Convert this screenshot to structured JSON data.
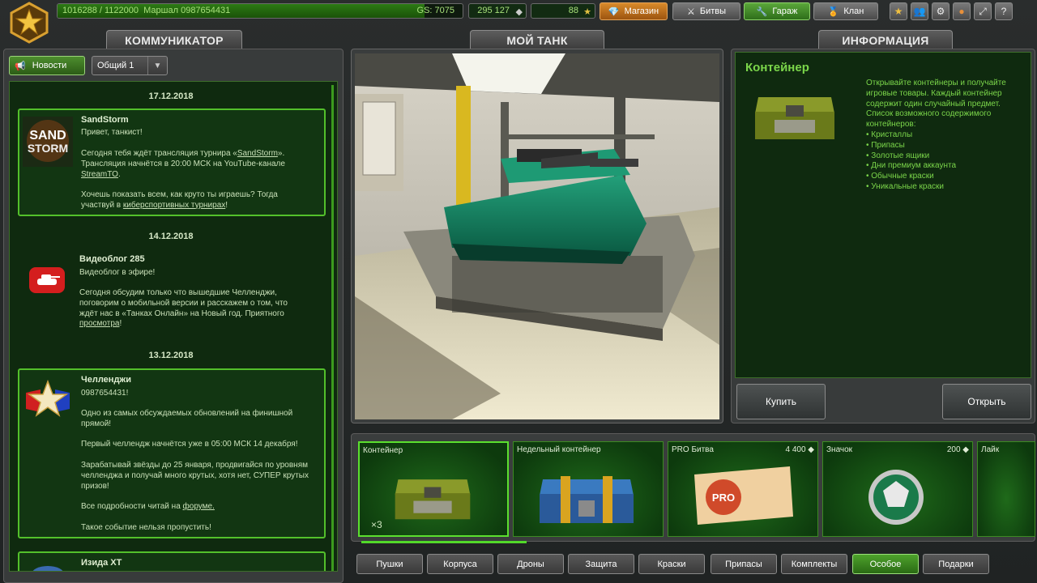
{
  "topbar": {
    "xp_text": "1016288 / 1122000",
    "rank_name": "Маршал",
    "player_name": "0987654431",
    "xp_progress": 0.906,
    "gs_text": "GS: 7075",
    "crystals": "295 127",
    "stars": "88",
    "shop_label": "Магазин",
    "battles_label": "Битвы",
    "garage_label": "Гараж",
    "clan_label": "Клан"
  },
  "tabs": {
    "communicator": "КОММУНИКАТОР",
    "my_tank": "МОЙ ТАНК",
    "info": "ИНФОРМАЦИЯ"
  },
  "communicator": {
    "news_button": "Новости",
    "channel_select": "Общий 1",
    "news": [
      {
        "date": "17.12.2018",
        "title": "SandStorm",
        "line1": "Привет, танкист!",
        "p1a": " Сегодня тебя ждёт трансляция турнира «",
        "p1link": "SandStorm",
        "p1b": "».",
        "p2a": "Трансляция начнётся в 20:00 МСК на YouTube-канале",
        "p2link": "StreamTO",
        "p2b": ".",
        "p3a": "Хочешь показать всем, как круто ты играешь? Тогда",
        "p3b": "участвуй в ",
        "p3link": "киберспортивных турнирах",
        "p3c": "!"
      },
      {
        "date": "14.12.2018",
        "title": "Видеоблог 285",
        "line1": "Видеоблог в эфире!",
        "p1": "Сегодня обсудим только что вышедшие Челленджи,",
        "p2": "поговорим о мобильной версии и расскажем о том, что",
        "p3": "ждёт нас в «Танках Онлайн» на Новый год. Приятного",
        "p4link": "просмотра",
        "p4b": "!"
      },
      {
        "date": "13.12.2018",
        "title": "Челленджи",
        "line1": "0987654431!",
        "p1": "Одно из самых обсуждаемых обновлений на финишной",
        "p1b": "прямой!",
        "p2": "Первый челлендж начнётся уже в 05:00 МСК 14 декабря!",
        "p3": "Зарабатывай звёзды до 25 января, продвигайся по уровням",
        "p3b": "челленджа и получай много крутых, хотя нет, СУПЕР крутых",
        "p3c": "призов!",
        "p4a": "Все подробности читай на ",
        "p4link": "форуме.",
        "p5": "Такое событие нельзя пропустить!"
      },
      {
        "title": "Изида XT"
      }
    ]
  },
  "info": {
    "title": "Контейнер",
    "desc1": "Открывайте контейнеры и получайте",
    "desc2": "игровые товары. Каждый контейнер",
    "desc3": "содержит один случайный предмет.",
    "desc4": "Список возможного содержимого",
    "desc5": "контейнеров:",
    "list": [
      "• Кристаллы",
      "• Припасы",
      "• Золотые ящики",
      "• Дни премиум аккаунта",
      "• Обычные краски",
      "• Уникальные краски"
    ],
    "buy_label": "Купить",
    "open_label": "Открыть"
  },
  "items": [
    {
      "name": "Контейнер",
      "qty": "×3",
      "price": ""
    },
    {
      "name": "Недельный контейнер",
      "price": ""
    },
    {
      "name": "PRO Битва",
      "price": "4 400"
    },
    {
      "name": "Значок",
      "price": "200"
    },
    {
      "name": "Лайк",
      "price": ""
    }
  ],
  "categories": [
    "Пушки",
    "Корпуса",
    "Дроны",
    "Защита",
    "Краски",
    "Припасы",
    "Комплекты",
    "Особое",
    "Подарки"
  ],
  "colors": {
    "accent_green": "#53c02b",
    "text_green": "#7bd64a",
    "shop_orange": "#d88a2a"
  }
}
